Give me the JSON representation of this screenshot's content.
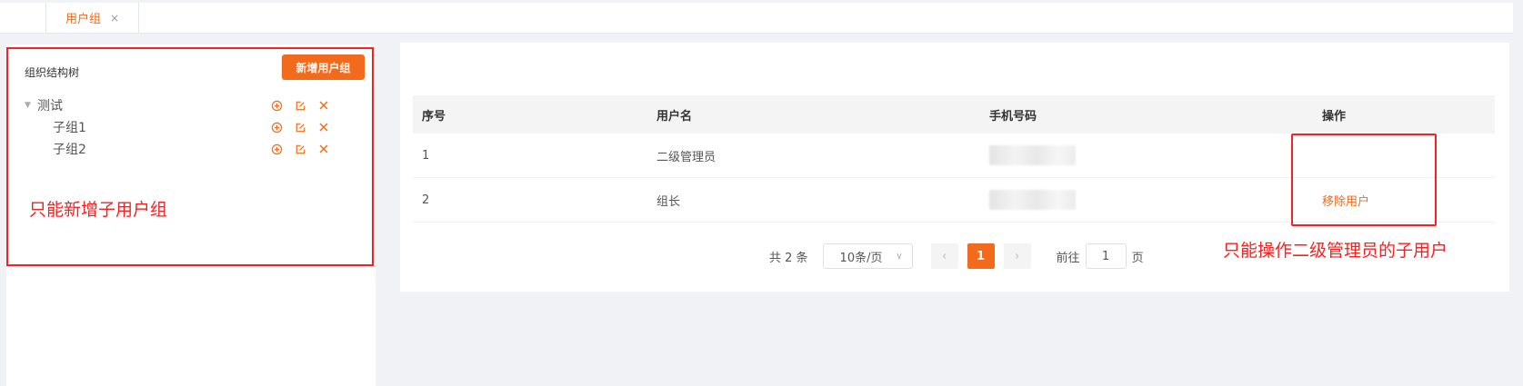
{
  "tabs": {
    "active_label": "用户组",
    "close_glyph": "×"
  },
  "left": {
    "title": "组织结构树",
    "add_group_label": "新增用户组",
    "tree": [
      {
        "label": "测试",
        "level": 0,
        "expanded": true
      },
      {
        "label": "子组1",
        "level": 1
      },
      {
        "label": "子组2",
        "level": 1
      }
    ],
    "node_action_icons": [
      "add-circle-icon",
      "edit-icon",
      "delete-icon"
    ],
    "annotation": "只能新增子用户组"
  },
  "table": {
    "headers": [
      "序号",
      "用户名",
      "手机号码",
      "操作"
    ],
    "rows": [
      {
        "index": "1",
        "username": "二级管理员",
        "phone_blurred": true,
        "action": ""
      },
      {
        "index": "2",
        "username": "组长",
        "phone_blurred": true,
        "action": "移除用户"
      }
    ],
    "annotation": "只能操作二级管理员的子用户"
  },
  "pagination": {
    "total": "共 2 条",
    "page_size": "10条/页",
    "current_page": "1",
    "goto_prefix": "前往",
    "goto_value": "1",
    "goto_suffix": "页"
  },
  "colors": {
    "accent": "#f26b1d",
    "annotation": "#f52222"
  }
}
